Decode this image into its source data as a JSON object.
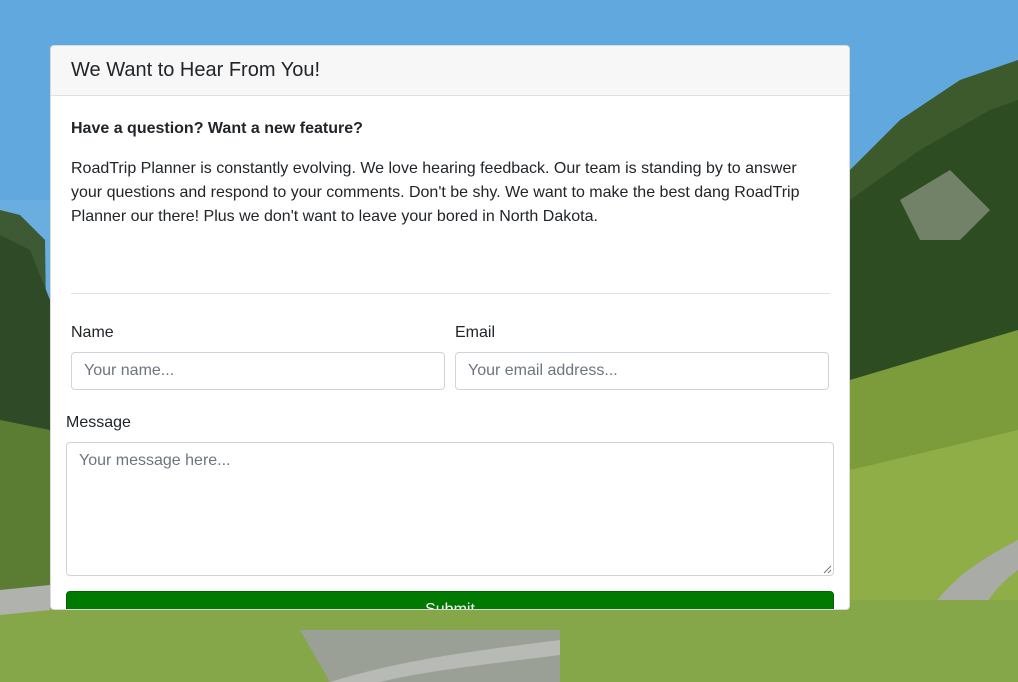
{
  "card": {
    "title": "We Want to Hear From You!",
    "question": "Have a question? Want a new feature?",
    "intro": "RoadTrip Planner is constantly evolving. We love hearing feedback. Our team is standing by to answer your questions and respond to your comments. Don't be shy. We want to make the best dang RoadTrip Planner our there! Plus we don't want to leave your bored in North Dakota."
  },
  "form": {
    "name_label": "Name",
    "name_placeholder": "Your name...",
    "email_label": "Email",
    "email_placeholder": "Your email address...",
    "message_label": "Message",
    "message_placeholder": "Your message here...",
    "submit_label": "Submit"
  },
  "colors": {
    "submit_bg": "#007a00",
    "card_header_bg": "#f7f7f7"
  }
}
